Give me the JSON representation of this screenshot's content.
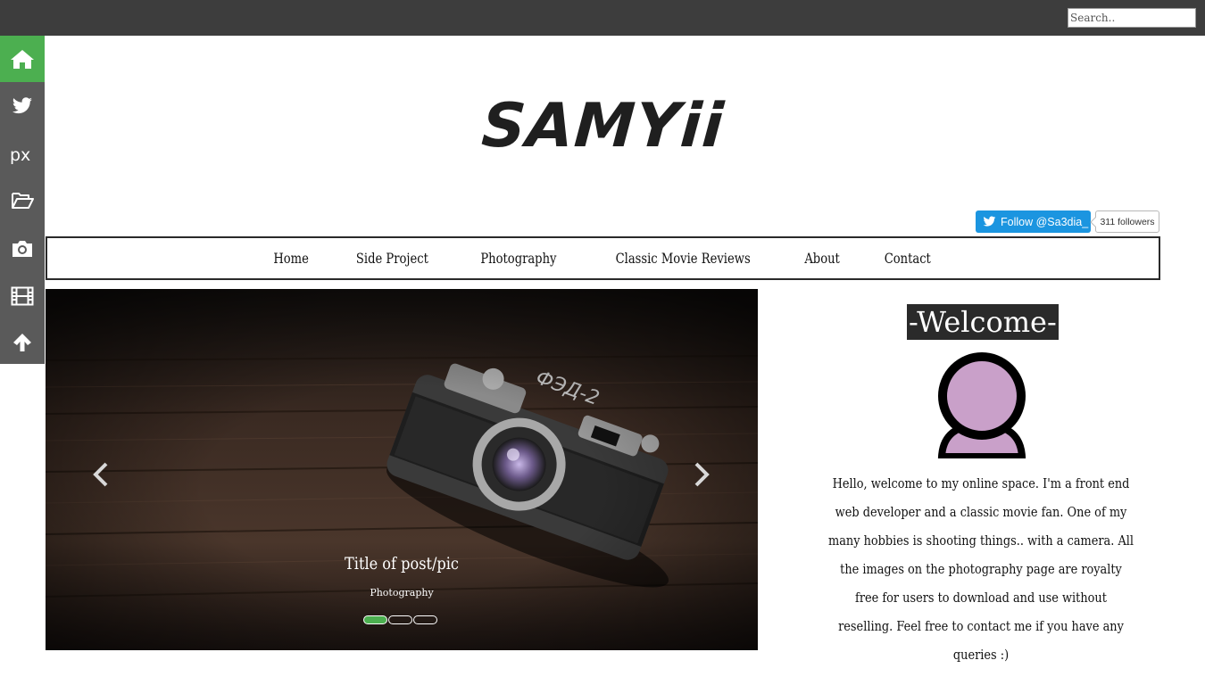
{
  "search": {
    "placeholder": "Search.."
  },
  "sidebar": {
    "items": [
      {
        "icon": "home-icon",
        "active": true
      },
      {
        "icon": "twitter-icon",
        "active": false
      },
      {
        "icon": "500px-icon",
        "active": false
      },
      {
        "icon": "folder-open-icon",
        "active": false
      },
      {
        "icon": "camera-icon",
        "active": false
      },
      {
        "icon": "film-icon",
        "active": false
      },
      {
        "icon": "arrow-up-icon",
        "active": false
      }
    ]
  },
  "header": {
    "logo": "SAMYii"
  },
  "twitter": {
    "follow_label": "Follow @Sa3dia_",
    "followers": "311 followers"
  },
  "nav": {
    "items": [
      "Home",
      "Side Project",
      "Photography",
      "Classic Movie Reviews",
      "About",
      "Contact"
    ]
  },
  "carousel": {
    "caption_title": "Title of post/pic",
    "caption_subtitle": "Photography",
    "slide_count": 3,
    "active_slide": 1
  },
  "welcome": {
    "heading": "-Welcome-",
    "intro": "Hello, welcome to my online space. I'm a front end web developer and a classic movie fan. One of my many hobbies is shooting things.. with a camera. All the images on the photography page are royalty free for users to download and use without reselling. Feel free to contact me if you have any queries :)"
  },
  "colors": {
    "topbar": "#3d3d3d",
    "sidebar": "#5a5a5a",
    "accent": "#4caf50",
    "twitter": "#1b95e0",
    "avatar_fill": "#c9a0c9"
  }
}
